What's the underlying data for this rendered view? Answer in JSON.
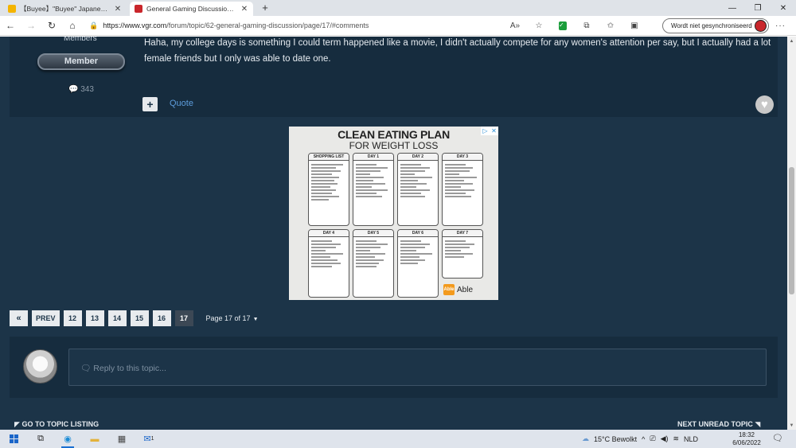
{
  "browser": {
    "tabs": [
      {
        "title": "【Buyee】\"Buyee\" Japanese Proxy",
        "active": false,
        "favicon_color": "#f4b400"
      },
      {
        "title": "General Gaming Discussion - Pag",
        "active": true,
        "favicon_color": "#c9262b"
      }
    ],
    "url_host": "https://www.vgr.com",
    "url_path": "/forum/topic/62-general-gaming-discussion/page/17/#comments",
    "profile_label": "Wordt niet gesynchroniseerd"
  },
  "post": {
    "group_title": "Members",
    "badge": "Member",
    "post_count": "343",
    "text": "Haha, my college days is something I could term happened like a movie, I didn't actually compete for any women's attention per say, but I actually had a lot female friends but I only was able to date one.",
    "quote_label": "Quote"
  },
  "ad": {
    "title_line1": "CLEAN EATING PLAN",
    "title_line2": "FOR WEIGHT LOSS",
    "cards": [
      "SHOPPING LIST",
      "DAY 1",
      "DAY 2",
      "DAY 3",
      "DAY 4",
      "DAY 5",
      "DAY 6",
      "DAY 7"
    ],
    "brand": "Able",
    "brand_mark": "Able"
  },
  "pagination": {
    "first": "«",
    "prev": "PREV",
    "pages": [
      "12",
      "13",
      "14",
      "15",
      "16",
      "17"
    ],
    "current": "17",
    "page_of": "Page 17 of 17"
  },
  "reply": {
    "placeholder": "Reply to this topic..."
  },
  "bottom_nav": {
    "left": "GO TO TOPIC LISTING",
    "right": "NEXT UNREAD TOPIC"
  },
  "taskbar": {
    "weather": "15°C  Bewolkt",
    "language": "NLD",
    "time": "18:32",
    "date": "6/06/2022",
    "mail_badge": "1"
  }
}
